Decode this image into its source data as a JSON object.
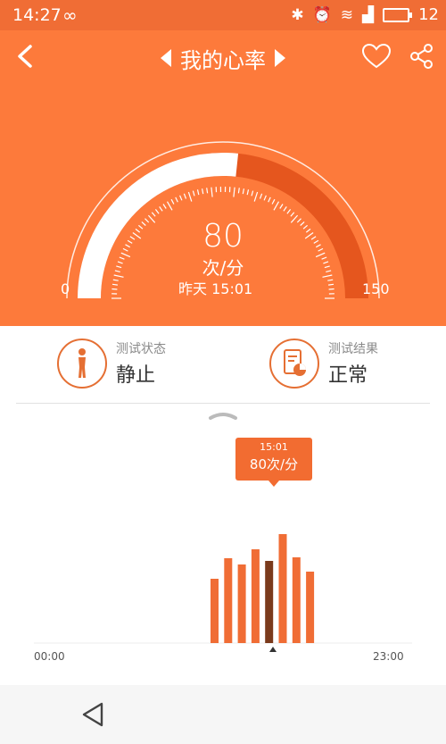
{
  "status_bar": {
    "time": "14:27",
    "loop_glyph": "∞",
    "right_text": "12",
    "icons": [
      "bluetooth-icon",
      "alarm-icon",
      "wifi-icon",
      "signal-icon",
      "battery-icon"
    ]
  },
  "app_bar": {
    "title": "我的心率",
    "icons": [
      "back-icon",
      "prev-arrow-icon",
      "next-arrow-icon",
      "heart-icon",
      "share-icon"
    ]
  },
  "gauge": {
    "value": "80",
    "unit": "次/分",
    "time": "昨天 15:01",
    "min": "0",
    "max": "150",
    "level": 0.5333
  },
  "test_status": {
    "label": "测试状态",
    "value": "静止"
  },
  "test_result": {
    "label": "测试结果",
    "value": "正常"
  },
  "chart": {
    "tooltip_time": "15:01",
    "tooltip_value": "80次/分",
    "x_start": "00:00",
    "x_end": "23:00"
  },
  "chart_data": {
    "type": "bar",
    "categories": [
      "",
      "",
      "",
      "",
      "",
      "",
      "",
      "",
      ""
    ],
    "values": [
      72,
      95,
      88,
      105,
      92,
      122,
      96,
      80,
      0
    ],
    "highlight_index": 4,
    "xlabel": "",
    "ylabel": ""
  },
  "colors": {
    "accent": "#fd7a3b",
    "bar": "#f06d35",
    "bar_highlight": "#7a3a1c",
    "text": "#333333"
  }
}
